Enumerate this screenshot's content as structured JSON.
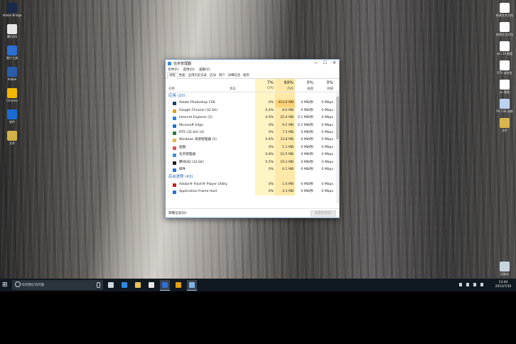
{
  "desktop": {
    "left_icons": [
      {
        "label": "Adobe Bridge",
        "icon": "bridge-icon",
        "color": "#1b2a4a"
      },
      {
        "label": "腾讯QQ",
        "icon": "qq-penguin-icon",
        "color": "#e6e6e6"
      },
      {
        "label": "图片工具",
        "icon": "image-tool-icon",
        "color": "#2b6fd0"
      },
      {
        "label": "Adobe",
        "icon": "adobe-icon",
        "color": "#2a5ca8"
      },
      {
        "label": "Chrome",
        "icon": "chrome-icon",
        "color": "#f2b705"
      },
      {
        "label": "软件",
        "icon": "monitor-icon",
        "color": "#1b6bd1"
      },
      {
        "label": "文件",
        "icon": "folder-icon",
        "color": "#d4b04b"
      }
    ],
    "right_icons": [
      {
        "label": "新建文本文档",
        "icon": "text-document-icon",
        "color": "#ffffff"
      },
      {
        "label": "新建文本文档",
        "icon": "text-document-icon",
        "color": "#ffffff"
      },
      {
        "label": "win 10 截图",
        "icon": "document-icon",
        "color": "#ffffff"
      },
      {
        "label": "RTX 安装包",
        "icon": "document-icon",
        "color": "#ffffff"
      },
      {
        "label": "ps 截图",
        "icon": "document-icon",
        "color": "#ffffff"
      },
      {
        "label": "PS CS6 安装",
        "icon": "ps-installer-icon",
        "color": "#bcd3f0"
      },
      {
        "label": "文件",
        "icon": "folder-icon",
        "color": "#d9b54e"
      },
      {
        "label": "回收站",
        "icon": "recycle-bin-icon",
        "color": "#c8d4de"
      }
    ]
  },
  "taskmgr": {
    "title": "任务管理器",
    "window_buttons": {
      "minimize": "—",
      "maximize": "☐",
      "close": "✕"
    },
    "menu": [
      "文件(F)",
      "选项(O)",
      "查看(V)"
    ],
    "tabs": [
      "进程",
      "性能",
      "应用历史记录",
      "启动",
      "用户",
      "详细信息",
      "服务"
    ],
    "header": {
      "name": "名称",
      "status": "状态",
      "cpu": {
        "pct": "7%",
        "label": "CPU"
      },
      "memory": {
        "pct": "89%",
        "label": "内存"
      },
      "disk": {
        "pct": "0%",
        "label": "磁盘"
      },
      "network": {
        "pct": "0%",
        "label": "网络"
      }
    },
    "groups": [
      {
        "title": "应用 (10)",
        "rows": [
          {
            "name": "Adobe Photoshop CS6",
            "cpu": "0%",
            "mem": "414.6 MB",
            "disk": "0 MB/秒",
            "net": "0 Mbps",
            "icon_color": "#1b3a70",
            "mem_heavy": true
          },
          {
            "name": "Google Chrome (32 bit)",
            "cpu": "0.4%",
            "mem": "8.6 MB",
            "disk": "0 MB/秒",
            "net": "0 Mbps",
            "icon_color": "#e0a010"
          },
          {
            "name": "Internet Explorer (2)",
            "cpu": "0.6%",
            "mem": "25.6 MB",
            "disk": "0.1 MB/秒",
            "net": "0 Mbps",
            "icon_color": "#2b7de0"
          },
          {
            "name": "Microsoft Edge",
            "cpu": "0%",
            "mem": "9.2 MB",
            "disk": "0.1 MB/秒",
            "net": "0 Mbps",
            "icon_color": "#1e6fc7"
          },
          {
            "name": "RTX (32 bit) (4)",
            "cpu": "0%",
            "mem": "7.5 MB",
            "disk": "0 MB/秒",
            "net": "0 Mbps",
            "icon_color": "#2a7a3a"
          },
          {
            "name": "Windows 资源管理器 (5)",
            "cpu": "0.6%",
            "mem": "33.8 MB",
            "disk": "0 MB/秒",
            "net": "0 Mbps",
            "icon_color": "#e0b84a"
          },
          {
            "name": "画图",
            "cpu": "0%",
            "mem": "1.1 MB",
            "disk": "0 MB/秒",
            "net": "0 Mbps",
            "icon_color": "#d9534f"
          },
          {
            "name": "任务管理器",
            "cpu": "0.8%",
            "mem": "10.5 MB",
            "disk": "0 MB/秒",
            "net": "0 Mbps",
            "icon_color": "#3a8fd6"
          },
          {
            "name": "腾讯QQ (32 bit)",
            "cpu": "0.5%",
            "mem": "19.2 MB",
            "disk": "0 MB/秒",
            "net": "0 Mbps",
            "icon_color": "#222222"
          },
          {
            "name": "邮件",
            "cpu": "0%",
            "mem": "0.1 MB",
            "disk": "0 MB/秒",
            "net": "0 Mbps",
            "icon_color": "#2f6fd0"
          }
        ]
      },
      {
        "title": "后台进程 (43)",
        "rows": [
          {
            "name": "Adobe® Flash® Player Utility",
            "cpu": "0%",
            "mem": "1.6 MB",
            "disk": "0 MB/秒",
            "net": "0 Mbps",
            "icon_color": "#c41e1e"
          },
          {
            "name": "Application Frame Host",
            "cpu": "0%",
            "mem": "4.3 MB",
            "disk": "0 MB/秒",
            "net": "0 Mbps",
            "icon_color": "#2b6fd0"
          }
        ]
      }
    ],
    "footer": {
      "fewer_details": "简略信息(D)",
      "end_task": "结束任务(E)"
    }
  },
  "taskbar": {
    "search_placeholder": "询问我任何问题",
    "pinned": [
      {
        "icon": "task-view-icon",
        "color": "#cfd6dc",
        "active": false
      },
      {
        "icon": "edge-icon",
        "color": "#2b8ae0",
        "active": false
      },
      {
        "icon": "file-explorer-icon",
        "color": "#e6c35a",
        "active": false
      },
      {
        "icon": "store-icon",
        "color": "#e8e8e8",
        "active": false
      },
      {
        "icon": "photoshop-icon",
        "color": "#2f6fd0",
        "active": true
      },
      {
        "icon": "chrome-icon",
        "color": "#e0a010",
        "active": false
      },
      {
        "icon": "task-manager-icon",
        "color": "#7fb3e6",
        "active": true
      }
    ],
    "tray": {
      "time": "13:44",
      "date": "2015/7/30"
    }
  },
  "colors": {
    "cpu_tint": "#fff4c4",
    "cpu_tint_active": "#ffe9a8",
    "mem_heavy": "#ffd37a",
    "group_title": "#1f5fa8",
    "taskbar": "#101820"
  }
}
